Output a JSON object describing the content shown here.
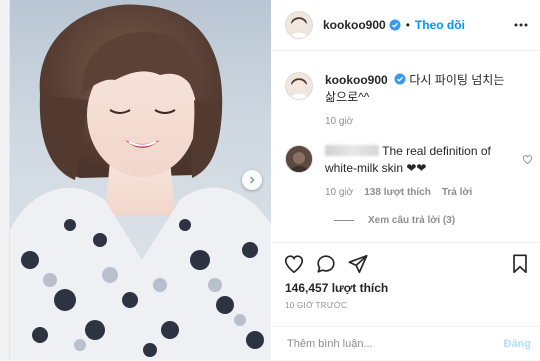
{
  "header": {
    "username": "kookoo900",
    "separator": "•",
    "follow_label": "Theo dõi",
    "avatar_icon": "profile-avatar",
    "verified_icon": "verified-badge-icon",
    "more_icon": "more-options-icon"
  },
  "caption": {
    "username": "kookoo900",
    "text": "다시 파이팅 넘치는 삶으로^^",
    "time": "10 giờ"
  },
  "comments": [
    {
      "text": "The real definition of white-milk skin ❤❤",
      "time": "10 giờ",
      "likes": "138 lượt thích",
      "reply_label": "Trả lời",
      "view_replies": "Xem câu trả lời (3)"
    }
  ],
  "actions": {
    "like_icon": "heart-icon",
    "comment_icon": "comment-icon",
    "share_icon": "share-icon",
    "save_icon": "bookmark-icon"
  },
  "likes_count": "146,457 lượt thích",
  "post_time": "10 GIỜ TRƯỚC",
  "add_comment": {
    "placeholder": "Thêm bình luận...",
    "post_label": "Đăng"
  },
  "colors": {
    "accent": "#0095f6",
    "post_disabled": "#b2dffc",
    "secondary_text": "#8e8e8e"
  }
}
